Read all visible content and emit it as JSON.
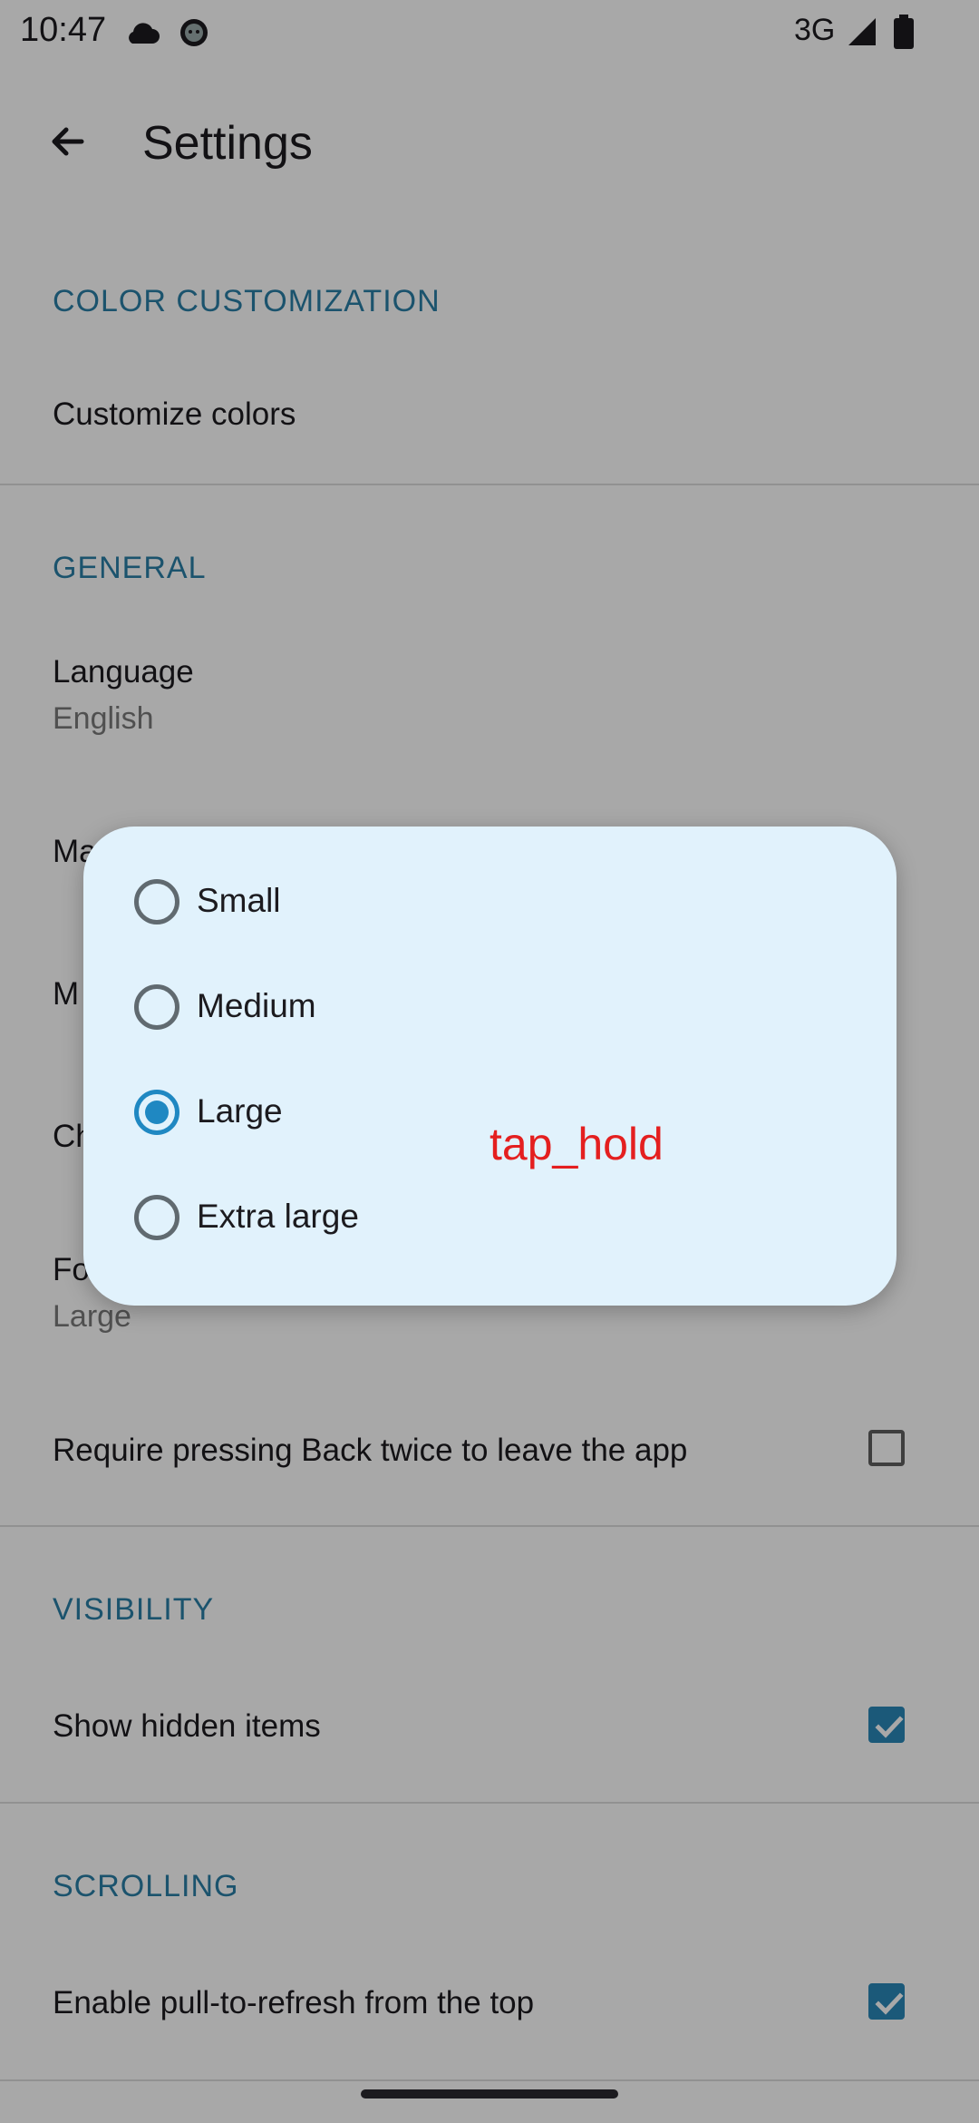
{
  "status_bar": {
    "time": "10:47",
    "network": "3G",
    "icons": [
      "cloud-icon",
      "android-icon",
      "signal-icon",
      "battery-icon"
    ]
  },
  "app_bar": {
    "title": "Settings",
    "back_icon": "arrow-back-icon"
  },
  "sections": {
    "color": {
      "header": "COLOR CUSTOMIZATION",
      "customize_colors": "Customize colors"
    },
    "general": {
      "header": "GENERAL",
      "language_title": "Language",
      "language_value": "English",
      "partial_item_1": "Ma",
      "partial_item_2": "M",
      "partial_item_3": "Ch",
      "font_size_title_partial": "Fo",
      "font_size_value": "Large",
      "back_twice_label": "Require pressing Back twice to leave the app",
      "back_twice_checked": false
    },
    "visibility": {
      "header": "VISIBILITY",
      "show_hidden_label": "Show hidden items",
      "show_hidden_checked": true
    },
    "scrolling": {
      "header": "SCROLLING",
      "pull_refresh_label": "Enable pull-to-refresh from the top",
      "pull_refresh_checked": true
    }
  },
  "dialog": {
    "options": [
      {
        "label": "Small",
        "selected": false
      },
      {
        "label": "Medium",
        "selected": false
      },
      {
        "label": "Large",
        "selected": true
      },
      {
        "label": "Extra large",
        "selected": false
      }
    ]
  },
  "overlay_label": "tap_hold",
  "colors": {
    "accent": "#1f88c2",
    "section_header": "#2a7ea6",
    "dialog_bg": "#e1f2fc",
    "overlay_text": "#e41f1f"
  }
}
